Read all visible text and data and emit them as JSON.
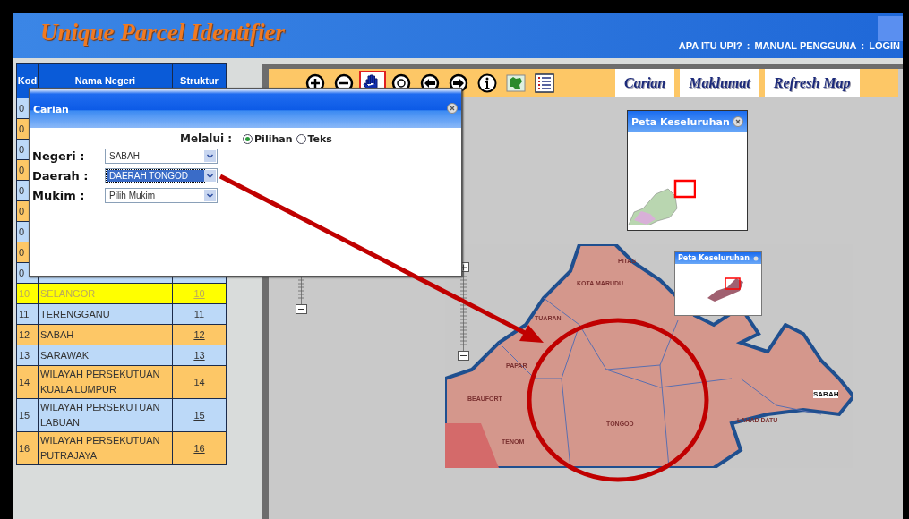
{
  "header": {
    "title": "Unique Parcel Identifier",
    "separator": ":",
    "links": [
      {
        "label": "APA ITU UPI?"
      },
      {
        "label": "MANUAL PENGGUNA"
      },
      {
        "label": "LOGIN"
      }
    ]
  },
  "table": {
    "columns": [
      "Kod",
      "Nama Negeri",
      "Struktur"
    ],
    "rows": [
      {
        "kod": "0",
        "selected": false
      },
      {
        "kod": "0",
        "selected": false
      },
      {
        "kod": "0",
        "selected": false
      },
      {
        "kod": "0",
        "selected": false
      },
      {
        "kod": "0",
        "selected": false
      },
      {
        "kod": "0",
        "selected": false
      },
      {
        "kod": "0",
        "selected": false
      },
      {
        "kod": "0",
        "selected": false
      },
      {
        "kod": "0",
        "selected": false
      },
      {
        "kod": "10",
        "name": "SELANGOR",
        "code": "10",
        "selected": true
      },
      {
        "kod": "11",
        "name": "TERENGGANU",
        "code": "11",
        "selected": false
      },
      {
        "kod": "12",
        "name": "SABAH",
        "code": "12",
        "selected": false
      },
      {
        "kod": "13",
        "name": "SARAWAK",
        "code": "13",
        "selected": false
      },
      {
        "kod": "14",
        "name": "WILAYAH PERSEKUTUAN KUALA LUMPUR",
        "code": "14",
        "selected": false
      },
      {
        "kod": "15",
        "name": "WILAYAH PERSEKUTUAN LABUAN",
        "code": "15",
        "selected": false
      },
      {
        "kod": "16",
        "name": "WILAYAH PERSEKUTUAN PUTRAJAYA",
        "code": "16",
        "selected": false
      }
    ]
  },
  "map_panel": {
    "tools": [
      {
        "kind": "zoom-in",
        "selected": false
      },
      {
        "kind": "zoom-out",
        "selected": false
      },
      {
        "kind": "pan",
        "selected": true
      },
      {
        "kind": "full-extent",
        "selected": false
      },
      {
        "kind": "back",
        "selected": false
      },
      {
        "kind": "forward",
        "selected": false
      },
      {
        "kind": "info",
        "selected": false
      },
      {
        "kind": "layer",
        "selected": false
      },
      {
        "kind": "legend",
        "selected": false
      }
    ],
    "tabs": [
      {
        "label": "Carian"
      },
      {
        "label": "Maklumat"
      },
      {
        "label": "Refresh Map"
      }
    ],
    "overview": {
      "title": "Peta Keseluruhan"
    },
    "map_image": {
      "overview_title": "Peta Keseluruhan",
      "labels": [
        {
          "text": "PITAS"
        },
        {
          "text": "KOTA MARUDU"
        },
        {
          "text": "TUARAN"
        },
        {
          "text": "PAPAR"
        },
        {
          "text": "BEAUFORT"
        },
        {
          "text": "TENOM"
        },
        {
          "text": "TONGOD"
        },
        {
          "text": "LAHAD DATU"
        },
        {
          "text": "SABAH"
        }
      ]
    }
  },
  "dialog": {
    "title": "Carian",
    "via_label": "Melalui :",
    "options": [
      {
        "label": "Pilihan",
        "selected": true
      },
      {
        "label": "Teks",
        "selected": false
      }
    ],
    "fields": [
      {
        "label": "Negeri :",
        "value": "SABAH",
        "highlighted": false
      },
      {
        "label": "Daerah :",
        "value": "DAERAH TONGOD",
        "highlighted": true
      },
      {
        "label": "Mukim :",
        "value": "Pilih Mukim",
        "highlighted": false
      }
    ]
  }
}
